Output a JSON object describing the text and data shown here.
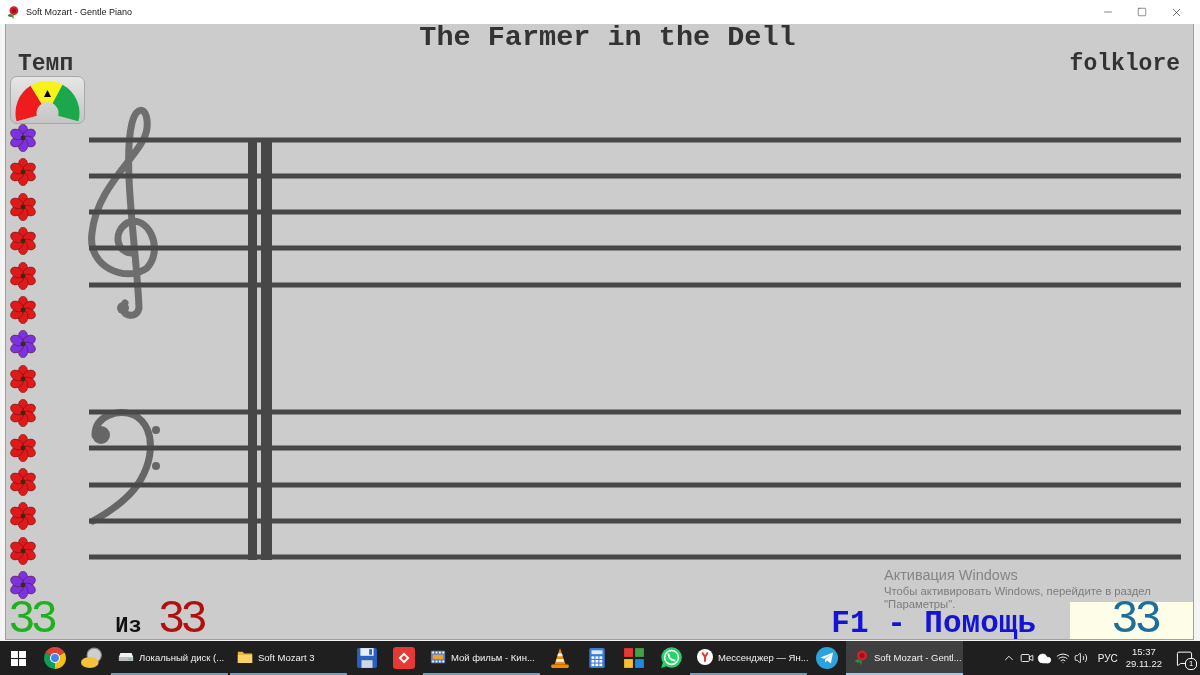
{
  "window": {
    "title": "Soft Mozart - Gentle Piano"
  },
  "song": {
    "title": "The Farmer in the Dell",
    "genre": "folklore"
  },
  "tempo": {
    "label": "Темп"
  },
  "flowers": [
    {
      "color": "#7b32e0"
    },
    {
      "color": "#e0191b"
    },
    {
      "color": "#e0191b"
    },
    {
      "color": "#e0191b"
    },
    {
      "color": "#e0191b"
    },
    {
      "color": "#e0191b"
    },
    {
      "color": "#7b32e0"
    },
    {
      "color": "#e0191b"
    },
    {
      "color": "#e0191b"
    },
    {
      "color": "#e0191b"
    },
    {
      "color": "#e0191b"
    },
    {
      "color": "#e0191b"
    },
    {
      "color": "#e0191b"
    },
    {
      "color": "#7b32e0"
    }
  ],
  "score": {
    "correct": "33",
    "of_label": "Из",
    "total": "33"
  },
  "help": "F1 - Помощь",
  "counter": "33",
  "activation_notice": {
    "title": "Активация Windows",
    "message": "Чтобы активировать Windows, перейдите в раздел \"Параметры\"."
  },
  "taskbar": {
    "items": [
      {
        "kind": "start"
      },
      {
        "kind": "pinned"
      },
      {
        "kind": "pinned"
      },
      {
        "kind": "window",
        "label": "Локальный диск (...",
        "selected": false
      },
      {
        "kind": "window",
        "label": "Soft Mozart 3",
        "selected": false
      },
      {
        "kind": "pinned"
      },
      {
        "kind": "pinned"
      },
      {
        "kind": "window",
        "label": "Мой фильм - Кин...",
        "selected": false
      },
      {
        "kind": "pinned"
      },
      {
        "kind": "pinned"
      },
      {
        "kind": "pinned"
      },
      {
        "kind": "pinned"
      },
      {
        "kind": "window",
        "label": "Мессенджер — Ян...",
        "selected": false
      },
      {
        "kind": "pinned"
      },
      {
        "kind": "window",
        "label": "Soft Mozart - Gentl...",
        "selected": true
      }
    ],
    "tray": {
      "language": "РУС",
      "time": "15:37",
      "date": "29.11.22",
      "notifications": "1"
    }
  }
}
